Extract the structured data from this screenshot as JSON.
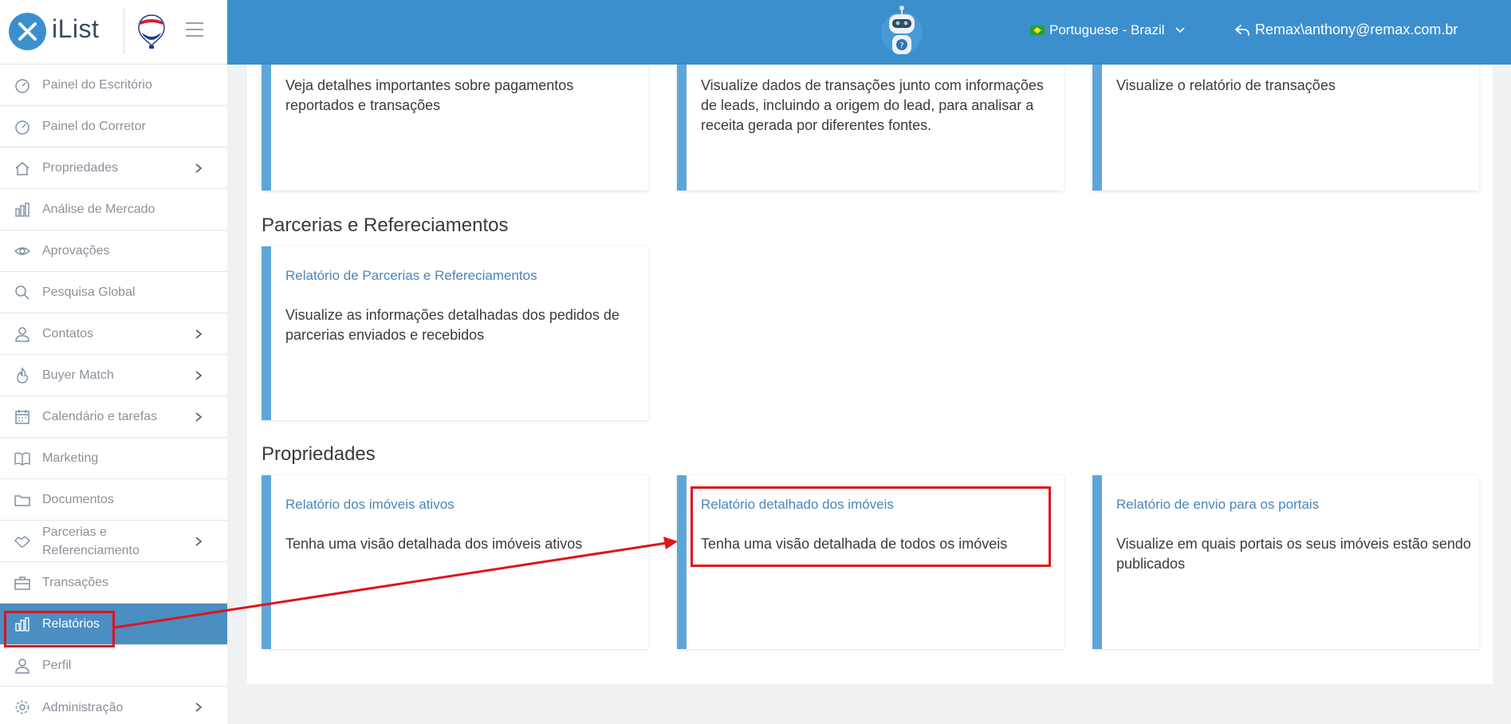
{
  "header": {
    "logo_text": "iList",
    "language": "Portuguese - Brazil",
    "user": "Remax\\anthony@remax.com.br"
  },
  "sidebar": {
    "items": [
      {
        "label": "Painel do Escritório"
      },
      {
        "label": "Painel do Corretor"
      },
      {
        "label": "Propriedades"
      },
      {
        "label": "Análise de Mercado"
      },
      {
        "label": "Aprovações"
      },
      {
        "label": "Pesquisa Global"
      },
      {
        "label": "Contatos"
      },
      {
        "label": "Buyer Match"
      },
      {
        "label": "Calendário e tarefas"
      },
      {
        "label": "Marketing"
      },
      {
        "label": "Documentos"
      },
      {
        "label": "Parcerias e Referenciamento"
      },
      {
        "label": "Transações"
      },
      {
        "label": "Relatórios"
      },
      {
        "label": "Perfil"
      },
      {
        "label": "Administração"
      }
    ]
  },
  "main": {
    "top_cards": [
      {
        "desc": "Veja detalhes importantes sobre pagamentos reportados e transações"
      },
      {
        "desc": "Visualize dados de transações junto com informações de leads, incluindo a origem do lead, para analisar a receita gerada por diferentes fontes."
      },
      {
        "desc": "Visualize o relatório de transações"
      }
    ],
    "section_parcerias": {
      "title": "Parcerias e Refereciamentos",
      "cards": [
        {
          "title": "Relatório de Parcerias e Refereciamentos",
          "desc": "Visualize as informações detalhadas dos pedidos de parcerias enviados e recebidos"
        }
      ]
    },
    "section_propriedades": {
      "title": "Propriedades",
      "cards": [
        {
          "title": "Relatório dos imóveis ativos",
          "desc": "Tenha uma visão detalhada dos imóveis ativos"
        },
        {
          "title": "Relatório detalhado dos imóveis",
          "desc": "Tenha uma visão detalhada de todos os imóveis"
        },
        {
          "title": "Relatório de envio para os portais",
          "desc": "Visualize em quais portais os seus imóveis estão sendo publicados"
        }
      ]
    }
  },
  "colors": {
    "header_bg": "#3c8fcd",
    "card_accent": "#5fa6d8",
    "active_nav": "#4a8ec2",
    "annotation": "#e0141b"
  }
}
